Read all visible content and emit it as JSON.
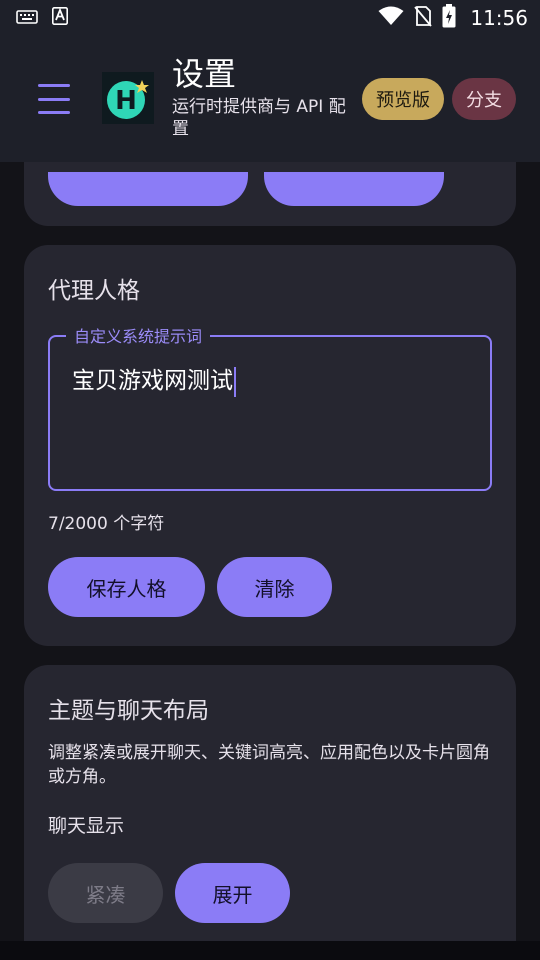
{
  "status_bar": {
    "time": "11:56",
    "left_icons": [
      "keyboard-icon",
      "a-text-icon"
    ],
    "right_icons": [
      "wifi-icon",
      "no-sim-icon",
      "battery-charging-icon"
    ]
  },
  "app_bar": {
    "title": "设置",
    "subtitle": "运行时提供商与 API 配置",
    "chip_preview": "预览版",
    "chip_branch": "分支",
    "menu_icon": "menu-icon",
    "logo_letter": "H"
  },
  "persona": {
    "title": "代理人格",
    "field_label": "自定义系统提示词",
    "field_value": "宝贝游戏网测试",
    "counter": "7/2000 个字符",
    "save_button": "保存人格",
    "clear_button": "清除"
  },
  "theme": {
    "title": "主题与聊天布局",
    "description": "调整紧凑或展开聊天、关键词高亮、应用配色以及卡片圆角或方角。",
    "chat_display_label": "聊天显示",
    "compact_button": "紧凑",
    "expand_button": "展开"
  },
  "colors": {
    "accent": "#8B7CF6",
    "card": "#262630",
    "appbar": "#1E2029",
    "chip_preview": "#C8A95C",
    "chip_branch": "#6A3544"
  }
}
